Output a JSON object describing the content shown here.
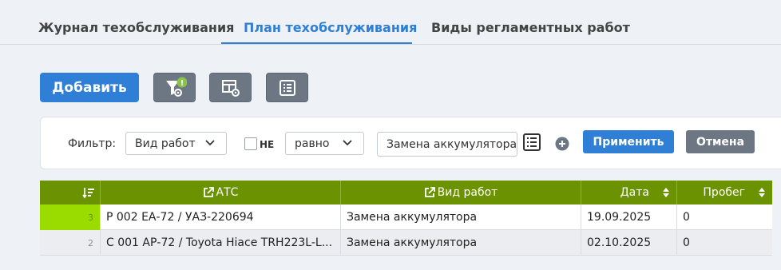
{
  "tabs": [
    {
      "label": "Журнал техобслуживания"
    },
    {
      "label": "План техобслуживания",
      "active": true
    },
    {
      "label": "Виды регламентных работ"
    }
  ],
  "toolbar": {
    "add_label": "Добавить",
    "filter_badge": "!"
  },
  "filter": {
    "label": "Фильтр:",
    "field": "Вид работ",
    "not_label": "НЕ",
    "not_checked": false,
    "operator": "равно",
    "value": "Замена аккумулятора",
    "apply_label": "Применить",
    "cancel_label": "Отмена"
  },
  "table": {
    "columns": [
      {
        "label": "",
        "icon": "sort-desc-icon"
      },
      {
        "label": "АТС",
        "icon": "external-link-icon"
      },
      {
        "label": "Вид работ",
        "icon": "external-link-icon"
      },
      {
        "label": "Дата",
        "icon": "sort-arrows-icon"
      },
      {
        "label": "Пробег",
        "icon": "sort-arrows-icon"
      }
    ],
    "rows": [
      {
        "num": "3",
        "vehicle": "Р 002 ЕА-72 / УАЗ-220694",
        "work": "Замена аккумулятора",
        "date": "19.09.2025",
        "mileage": "0",
        "selected": true
      },
      {
        "num": "2",
        "vehicle": "С 001 АР-72 / Toyota Hiace TRH223L-L...",
        "work": "Замена аккумулятора",
        "date": "02.10.2025",
        "mileage": "0",
        "selected": false
      }
    ]
  },
  "colors": {
    "accent": "#2f7fd6",
    "header_green": "#6b9200",
    "selected_row_marker": "#9bdc00",
    "badge": "#8bc34a"
  }
}
